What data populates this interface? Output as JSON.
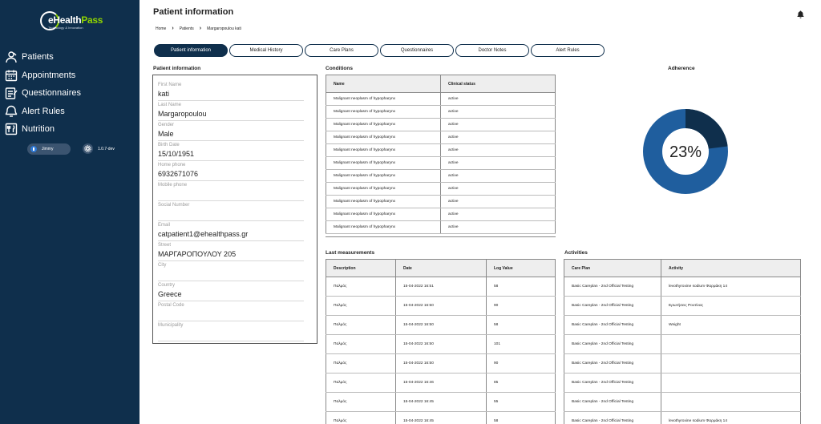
{
  "sidebar": {
    "logo": {
      "text_main": "eHealth",
      "text_accent": "Pass",
      "tagline": "Technology & Innovation"
    },
    "items": [
      {
        "label": "Patients",
        "icon": "patients-icon"
      },
      {
        "label": "Appointments",
        "icon": "calendar-icon"
      },
      {
        "label": "Questionnaires",
        "icon": "questionnaire-icon"
      },
      {
        "label": "Alert Rules",
        "icon": "alert-icon"
      },
      {
        "label": "Nutrition",
        "icon": "nutrition-icon"
      }
    ],
    "user": "Jimmy",
    "version": "1.0.7-dev"
  },
  "header": {
    "title": "Patient information",
    "breadcrumb": [
      "Home",
      "Patients",
      "Margaropoulou kati"
    ]
  },
  "tabs": [
    {
      "label": "Patient information",
      "active": true
    },
    {
      "label": "Medical History",
      "active": false
    },
    {
      "label": "Care Plans",
      "active": false
    },
    {
      "label": "Questionnaires",
      "active": false
    },
    {
      "label": "Doctor Notes",
      "active": false
    },
    {
      "label": "Alert Rules",
      "active": false
    }
  ],
  "patient": {
    "section_title": "Patient information",
    "fields": [
      {
        "label": "First Name",
        "value": "kati"
      },
      {
        "label": "Last Name",
        "value": "Margaropoulou"
      },
      {
        "label": "Gender",
        "value": "Male"
      },
      {
        "label": "Birth Date",
        "value": "15/10/1951"
      },
      {
        "label": "Home phone",
        "value": "6932671076"
      },
      {
        "label": "Mobile phone",
        "value": ""
      },
      {
        "label": "Social Number",
        "value": ""
      },
      {
        "label": "Email",
        "value": "catpatient1@ehealthpass.gr"
      },
      {
        "label": "Street",
        "value": "ΜΑΡΓΑΡΟΠΟΥΛΟΥ 205"
      },
      {
        "label": "City",
        "value": ""
      },
      {
        "label": "Country",
        "value": "Greece"
      },
      {
        "label": "Postal Code",
        "value": ""
      },
      {
        "label": "Municipality",
        "value": ""
      }
    ]
  },
  "conditions": {
    "title": "Conditions",
    "columns": [
      "Name",
      "Clinical status"
    ],
    "rows": [
      [
        "Malignant neoplasm of hypopharynx",
        "active"
      ],
      [
        "Malignant neoplasm of hypopharynx",
        "active"
      ],
      [
        "Malignant neoplasm of hypopharynx",
        "active"
      ],
      [
        "Malignant neoplasm of hypopharynx",
        "active"
      ],
      [
        "Malignant neoplasm of hypopharynx",
        "active"
      ],
      [
        "Malignant neoplasm of hypopharynx",
        "active"
      ],
      [
        "Malignant neoplasm of hypopharynx",
        "active"
      ],
      [
        "Malignant neoplasm of hypopharynx",
        "active"
      ],
      [
        "Malignant neoplasm of hypopharynx",
        "active"
      ],
      [
        "Malignant neoplasm of hypopharynx",
        "active"
      ],
      [
        "Malignant neoplasm of hypopharynx",
        "active"
      ]
    ]
  },
  "adherence": {
    "title": "Adherence",
    "percent": 23,
    "label": "23%",
    "color_fill": "#0f2f4c",
    "color_rest": "#1f5e9e"
  },
  "measurements": {
    "title": "Last measurements",
    "columns": [
      "Description",
      "Date",
      "Log Value"
    ],
    "rows": [
      [
        "Παλμός",
        "15-04-2022 16:51",
        "58"
      ],
      [
        "Παλμός",
        "15-04-2022 16:50",
        "90"
      ],
      [
        "Παλμός",
        "15-04-2022 16:50",
        "58"
      ],
      [
        "Παλμός",
        "15-04-2022 16:50",
        "101"
      ],
      [
        "Παλμός",
        "15-04-2022 16:50",
        "90"
      ],
      [
        "Παλμός",
        "15-04-2022 16:46",
        "85"
      ],
      [
        "Παλμός",
        "15-04-2022 16:45",
        "55"
      ],
      [
        "Παλμός",
        "15-04-2022 16:45",
        "58"
      ]
    ]
  },
  "activities": {
    "title": "Activities",
    "columns": [
      "Care Plan",
      "Activity"
    ],
    "rows": [
      [
        "Basic Careplan - 2nd Official Testing",
        "levothyroxine sodium Φαρμάκη 14"
      ],
      [
        "Basic Careplan - 2nd Official Testing",
        "Ερωτήσεις Ρουτίνας"
      ],
      [
        "Basic Careplan - 2nd Official Testing",
        "Weight"
      ],
      [
        "Basic Careplan - 2nd Official Testing",
        ""
      ],
      [
        "Basic Careplan - 2nd Official Testing",
        ""
      ],
      [
        "Basic Careplan - 2nd Official Testing",
        ""
      ],
      [
        "Basic Careplan - 2nd Official Testing",
        ""
      ],
      [
        "Basic Careplan - 2nd Official Testing",
        "levothyroxine sodium Φαρμάκη 14"
      ]
    ]
  }
}
